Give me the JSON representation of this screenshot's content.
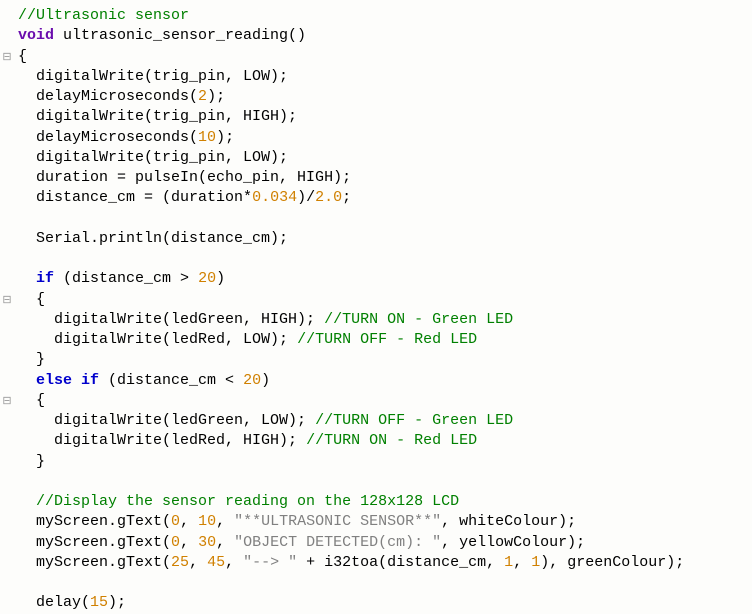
{
  "code": {
    "lines": [
      {
        "indent": 0,
        "segs": [
          {
            "cls": "c-comment",
            "t": "//Ultrasonic sensor"
          }
        ]
      },
      {
        "indent": 0,
        "segs": [
          {
            "cls": "c-keyword2",
            "t": "void"
          },
          {
            "cls": "c-plain",
            "t": " ultrasonic_sensor_reading()"
          }
        ]
      },
      {
        "indent": 0,
        "segs": [
          {
            "cls": "c-plain",
            "t": "{"
          }
        ]
      },
      {
        "indent": 1,
        "segs": [
          {
            "cls": "c-plain",
            "t": "digitalWrite(trig_pin, LOW);"
          }
        ]
      },
      {
        "indent": 1,
        "segs": [
          {
            "cls": "c-plain",
            "t": "delayMicroseconds("
          },
          {
            "cls": "c-num",
            "t": "2"
          },
          {
            "cls": "c-plain",
            "t": ");"
          }
        ]
      },
      {
        "indent": 1,
        "segs": [
          {
            "cls": "c-plain",
            "t": "digitalWrite(trig_pin, HIGH);"
          }
        ]
      },
      {
        "indent": 1,
        "segs": [
          {
            "cls": "c-plain",
            "t": "delayMicroseconds("
          },
          {
            "cls": "c-num",
            "t": "10"
          },
          {
            "cls": "c-plain",
            "t": ");"
          }
        ]
      },
      {
        "indent": 1,
        "segs": [
          {
            "cls": "c-plain",
            "t": "digitalWrite(trig_pin, LOW);"
          }
        ]
      },
      {
        "indent": 1,
        "segs": [
          {
            "cls": "c-plain",
            "t": "duration = pulseIn(echo_pin, HIGH);"
          }
        ]
      },
      {
        "indent": 1,
        "segs": [
          {
            "cls": "c-plain",
            "t": "distance_cm = (duration*"
          },
          {
            "cls": "c-num",
            "t": "0.034"
          },
          {
            "cls": "c-plain",
            "t": ")/"
          },
          {
            "cls": "c-num",
            "t": "2.0"
          },
          {
            "cls": "c-plain",
            "t": ";"
          }
        ]
      },
      {
        "indent": 0,
        "segs": [
          {
            "cls": "c-plain",
            "t": " "
          }
        ]
      },
      {
        "indent": 1,
        "segs": [
          {
            "cls": "c-plain",
            "t": "Serial.println(distance_cm);"
          }
        ]
      },
      {
        "indent": 0,
        "segs": [
          {
            "cls": "c-plain",
            "t": " "
          }
        ]
      },
      {
        "indent": 1,
        "segs": [
          {
            "cls": "c-keyword",
            "t": "if"
          },
          {
            "cls": "c-plain",
            "t": " (distance_cm > "
          },
          {
            "cls": "c-num",
            "t": "20"
          },
          {
            "cls": "c-plain",
            "t": ")"
          }
        ]
      },
      {
        "indent": 1,
        "segs": [
          {
            "cls": "c-plain",
            "t": "{"
          }
        ]
      },
      {
        "indent": 2,
        "segs": [
          {
            "cls": "c-plain",
            "t": "digitalWrite(ledGreen, HIGH); "
          },
          {
            "cls": "c-comment",
            "t": "//TURN ON - Green LED"
          }
        ]
      },
      {
        "indent": 2,
        "segs": [
          {
            "cls": "c-plain",
            "t": "digitalWrite(ledRed, LOW); "
          },
          {
            "cls": "c-comment",
            "t": "//TURN OFF - Red LED"
          }
        ]
      },
      {
        "indent": 1,
        "segs": [
          {
            "cls": "c-plain",
            "t": "}"
          }
        ]
      },
      {
        "indent": 1,
        "segs": [
          {
            "cls": "c-keyword",
            "t": "else if"
          },
          {
            "cls": "c-plain",
            "t": " (distance_cm < "
          },
          {
            "cls": "c-num",
            "t": "20"
          },
          {
            "cls": "c-plain",
            "t": ")"
          }
        ]
      },
      {
        "indent": 1,
        "segs": [
          {
            "cls": "c-plain",
            "t": "{"
          }
        ]
      },
      {
        "indent": 2,
        "segs": [
          {
            "cls": "c-plain",
            "t": "digitalWrite(ledGreen, LOW); "
          },
          {
            "cls": "c-comment",
            "t": "//TURN OFF - Green LED"
          }
        ]
      },
      {
        "indent": 2,
        "segs": [
          {
            "cls": "c-plain",
            "t": "digitalWrite(ledRed, HIGH); "
          },
          {
            "cls": "c-comment",
            "t": "//TURN ON - Red LED"
          }
        ]
      },
      {
        "indent": 1,
        "segs": [
          {
            "cls": "c-plain",
            "t": "}"
          }
        ]
      },
      {
        "indent": 0,
        "segs": [
          {
            "cls": "c-plain",
            "t": " "
          }
        ]
      },
      {
        "indent": 1,
        "segs": [
          {
            "cls": "c-comment",
            "t": "//Display the sensor reading on the 128x128 LCD"
          }
        ]
      },
      {
        "indent": 1,
        "segs": [
          {
            "cls": "c-plain",
            "t": "myScreen.gText("
          },
          {
            "cls": "c-num",
            "t": "0"
          },
          {
            "cls": "c-plain",
            "t": ", "
          },
          {
            "cls": "c-num",
            "t": "10"
          },
          {
            "cls": "c-plain",
            "t": ", "
          },
          {
            "cls": "c-str",
            "t": "\"**ULTRASONIC SENSOR**\""
          },
          {
            "cls": "c-plain",
            "t": ", whiteColour);"
          }
        ]
      },
      {
        "indent": 1,
        "segs": [
          {
            "cls": "c-plain",
            "t": "myScreen.gText("
          },
          {
            "cls": "c-num",
            "t": "0"
          },
          {
            "cls": "c-plain",
            "t": ", "
          },
          {
            "cls": "c-num",
            "t": "30"
          },
          {
            "cls": "c-plain",
            "t": ", "
          },
          {
            "cls": "c-str",
            "t": "\"OBJECT DETECTED(cm): \""
          },
          {
            "cls": "c-plain",
            "t": ", yellowColour);"
          }
        ]
      },
      {
        "indent": 1,
        "segs": [
          {
            "cls": "c-plain",
            "t": "myScreen.gText("
          },
          {
            "cls": "c-num",
            "t": "25"
          },
          {
            "cls": "c-plain",
            "t": ", "
          },
          {
            "cls": "c-num",
            "t": "45"
          },
          {
            "cls": "c-plain",
            "t": ", "
          },
          {
            "cls": "c-str",
            "t": "\"--> \""
          },
          {
            "cls": "c-plain",
            "t": " + i32toa(distance_cm, "
          },
          {
            "cls": "c-num",
            "t": "1"
          },
          {
            "cls": "c-plain",
            "t": ", "
          },
          {
            "cls": "c-num",
            "t": "1"
          },
          {
            "cls": "c-plain",
            "t": "), greenColour);"
          }
        ]
      },
      {
        "indent": 0,
        "segs": [
          {
            "cls": "c-plain",
            "t": " "
          }
        ]
      },
      {
        "indent": 1,
        "segs": [
          {
            "cls": "c-plain",
            "t": "delay("
          },
          {
            "cls": "c-num",
            "t": "15"
          },
          {
            "cls": "c-plain",
            "t": ");"
          }
        ]
      }
    ],
    "fold_marks": [
      2,
      14,
      19
    ]
  }
}
